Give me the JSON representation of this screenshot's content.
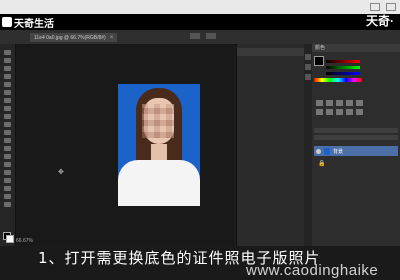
{
  "brand": {
    "left": "天奇生活",
    "right": "天奇·"
  },
  "document_tab": {
    "title": "11e4 0a0.jpg @ 66.7%(RGB/8#)",
    "close": "×"
  },
  "status_bar": {
    "zoom": "66.67%"
  },
  "panels": {
    "color_header": "颜色",
    "adjustments_header": "调整",
    "layers_header": "图层",
    "layer_name": "背景"
  },
  "subtitle": "1、打开需更换底色的证件照电子版照片",
  "watermark": "www.caodinghaike",
  "icons": [
    "window-minimize-icon",
    "window-close-icon",
    "eye-icon",
    "lock-icon",
    "cursor-icon"
  ],
  "colors": {
    "photo_background": "#1b63c8",
    "layer_selected": "#4d6fa8"
  }
}
